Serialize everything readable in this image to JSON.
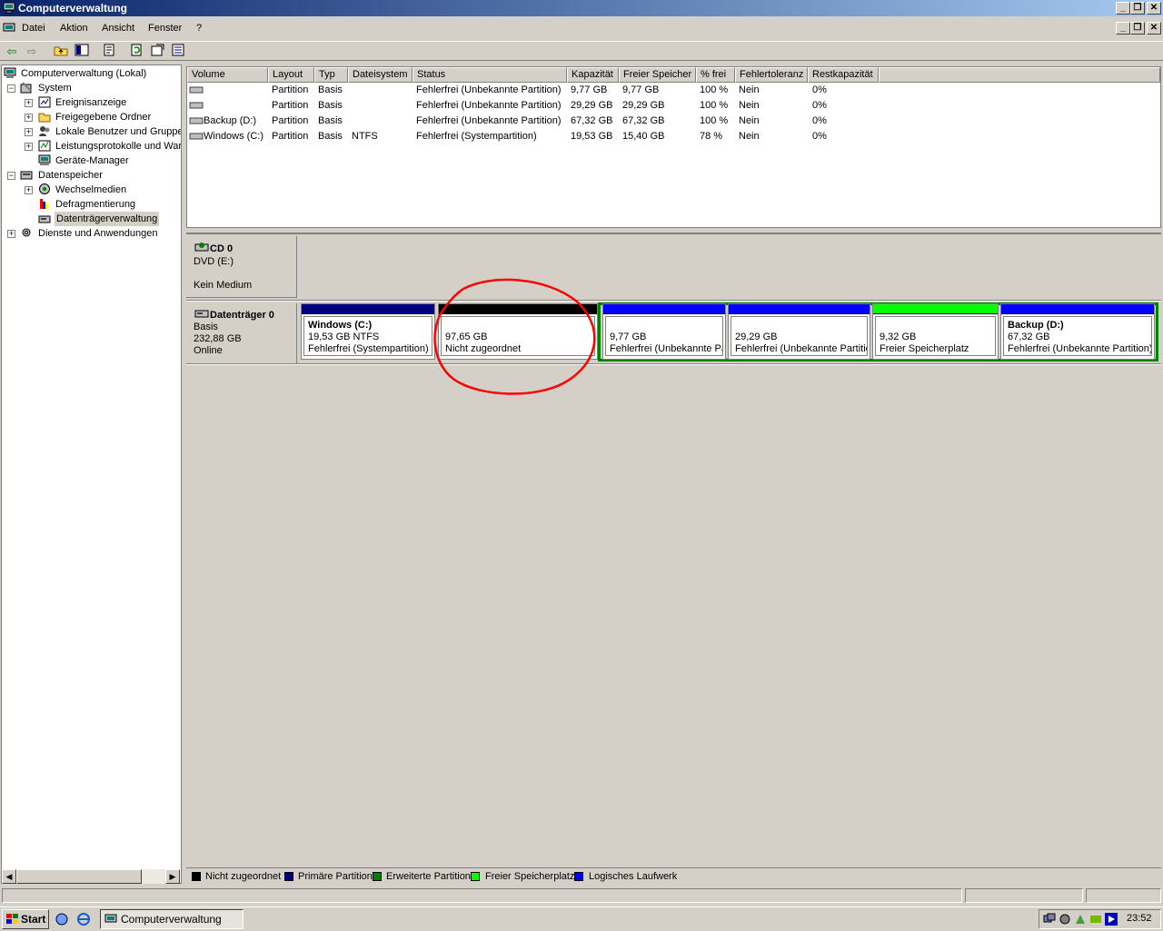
{
  "window": {
    "title": "Computerverwaltung",
    "min": "_",
    "restore": "❐",
    "close": "✕"
  },
  "menu": {
    "items": [
      "Datei",
      "Aktion",
      "Ansicht",
      "Fenster",
      "?"
    ]
  },
  "toolbar": {
    "back_icon": "back-arrow-icon",
    "forward_icon": "forward-arrow-icon"
  },
  "tree": {
    "root": "Computerverwaltung (Lokal)",
    "system": "System",
    "ereignis": "Ereignisanzeige",
    "freigabe": "Freigegebene Ordner",
    "benutzer": "Lokale Benutzer und Gruppen",
    "leistung": "Leistungsprotokolle und Warnungen",
    "geraete": "Geräte-Manager",
    "datenspeicher": "Datenspeicher",
    "wechsel": "Wechselmedien",
    "defrag": "Defragmentierung",
    "dtv": "Datenträgerverwaltung",
    "dienste": "Dienste und Anwendungen"
  },
  "volumes": {
    "headers": [
      "Volume",
      "Layout",
      "Typ",
      "Dateisystem",
      "Status",
      "Kapazität",
      "Freier Speicher",
      "% frei",
      "Fehlertoleranz",
      "Restkapazität"
    ],
    "rows": [
      [
        "",
        "Partition",
        "Basis",
        "",
        "Fehlerfrei (Unbekannte Partition)",
        "9,77 GB",
        "9,77 GB",
        "100 %",
        "Nein",
        "0%"
      ],
      [
        "",
        "Partition",
        "Basis",
        "",
        "Fehlerfrei (Unbekannte Partition)",
        "29,29 GB",
        "29,29 GB",
        "100 %",
        "Nein",
        "0%"
      ],
      [
        "Backup (D:)",
        "Partition",
        "Basis",
        "",
        "Fehlerfrei (Unbekannte Partition)",
        "67,32 GB",
        "67,32 GB",
        "100 %",
        "Nein",
        "0%"
      ],
      [
        "Windows (C:)",
        "Partition",
        "Basis",
        "NTFS",
        "Fehlerfrei (Systempartition)",
        "19,53 GB",
        "15,40 GB",
        "78 %",
        "Nein",
        "0%"
      ]
    ]
  },
  "cd": {
    "name": "CD 0",
    "type": "DVD (E:)",
    "status": "Kein Medium"
  },
  "disk0": {
    "name": "Datenträger 0",
    "type": "Basis",
    "size": "232,88 GB",
    "status": "Online"
  },
  "partitions": [
    {
      "title": "Windows  (C:)",
      "size": "19,53 GB NTFS",
      "status": "Fehlerfrei (Systempartition)"
    },
    {
      "title": "",
      "size": "97,65 GB",
      "status": "Nicht zugeordnet"
    },
    {
      "title": "",
      "size": "9,77 GB",
      "status": "Fehlerfrei (Unbekannte Partition)"
    },
    {
      "title": "",
      "size": "29,29 GB",
      "status": "Fehlerfrei (Unbekannte Partition)"
    },
    {
      "title": "",
      "size": "9,32 GB",
      "status": "Freier Speicherplatz"
    },
    {
      "title": "Backup  (D:)",
      "size": "67,32 GB",
      "status": "Fehlerfrei (Unbekannte Partition)"
    }
  ],
  "legend": [
    "Nicht zugeordnet",
    "Primäre Partition",
    "Erweiterte Partition",
    "Freier Speicherplatz",
    "Logisches Laufwerk"
  ],
  "colors": {
    "unallocated": "#000000",
    "primary": "#000080",
    "extended": "#008000",
    "free": "#00ff00",
    "logical": "#0000ff",
    "annotation": "#ff0000"
  },
  "taskbar": {
    "start": "Start",
    "task": "Computerverwaltung",
    "clock": "23:52"
  }
}
